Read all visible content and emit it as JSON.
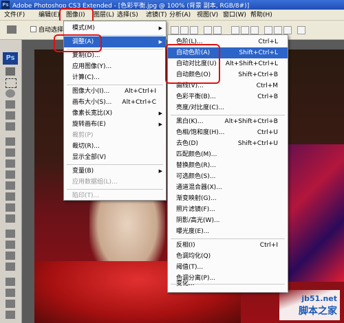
{
  "window": {
    "title": "Adobe Photoshop CS3 Extended - [色彩平衡.jpg @ 100% (背景 副本, RGB/8#)]",
    "app_badge": "Ps"
  },
  "menubar": {
    "items": [
      "文件(F)",
      "编辑(E)",
      "图像(I)",
      "图层(L)",
      "选择(S)",
      "滤镜(T)",
      "分析(A)",
      "视图(V)",
      "窗口(W)",
      "帮助(H)"
    ]
  },
  "optionsbar": {
    "auto_select_label": "自动选择"
  },
  "toolbox": {
    "badge": "Ps"
  },
  "image_menu": {
    "items": [
      {
        "label": "模式(M)",
        "shortcut": "",
        "submenu": true,
        "disabled": false
      },
      {
        "label": "调整(A)",
        "shortcut": "",
        "submenu": true,
        "disabled": false,
        "highlighted": true
      },
      {
        "label": "复制(D)...",
        "shortcut": "",
        "submenu": false,
        "disabled": false
      },
      {
        "label": "应用图像(Y)...",
        "shortcut": "",
        "submenu": false,
        "disabled": false
      },
      {
        "label": "计算(C)...",
        "shortcut": "",
        "submenu": false,
        "disabled": false
      },
      {
        "label": "图像大小(I)...",
        "shortcut": "Alt+Ctrl+I",
        "submenu": false,
        "disabled": false
      },
      {
        "label": "画布大小(S)...",
        "shortcut": "Alt+Ctrl+C",
        "submenu": false,
        "disabled": false
      },
      {
        "label": "像素长宽比(X)",
        "shortcut": "",
        "submenu": true,
        "disabled": false
      },
      {
        "label": "旋转画布(E)",
        "shortcut": "",
        "submenu": true,
        "disabled": false
      },
      {
        "label": "裁剪(P)",
        "shortcut": "",
        "submenu": false,
        "disabled": true
      },
      {
        "label": "裁切(R)...",
        "shortcut": "",
        "submenu": false,
        "disabled": false
      },
      {
        "label": "显示全部(V)",
        "shortcut": "",
        "submenu": false,
        "disabled": false
      },
      {
        "label": "变量(B)",
        "shortcut": "",
        "submenu": true,
        "disabled": false
      },
      {
        "label": "应用数据组(L)...",
        "shortcut": "",
        "submenu": false,
        "disabled": true
      },
      {
        "label": "陷印(T)...",
        "shortcut": "",
        "submenu": false,
        "disabled": true
      }
    ]
  },
  "adjust_menu": {
    "items": [
      {
        "label": "色阶(L)...",
        "shortcut": "Ctrl+L"
      },
      {
        "label": "自动色阶(A)",
        "shortcut": "Shift+Ctrl+L",
        "highlighted": true
      },
      {
        "label": "自动对比度(U)",
        "shortcut": "Alt+Shift+Ctrl+L"
      },
      {
        "label": "自动颜色(O)",
        "shortcut": "Shift+Ctrl+B"
      },
      {
        "label": "曲线(V)...",
        "shortcut": "Ctrl+M"
      },
      {
        "label": "色彩平衡(B)...",
        "shortcut": "Ctrl+B"
      },
      {
        "label": "亮度/对比度(C)...",
        "shortcut": ""
      },
      {
        "label": "黑白(K)...",
        "shortcut": "Alt+Shift+Ctrl+B"
      },
      {
        "label": "色相/饱和度(H)...",
        "shortcut": "Ctrl+U"
      },
      {
        "label": "去色(D)",
        "shortcut": "Shift+Ctrl+U"
      },
      {
        "label": "匹配颜色(M)...",
        "shortcut": ""
      },
      {
        "label": "替换颜色(R)...",
        "shortcut": ""
      },
      {
        "label": "可选颜色(S)...",
        "shortcut": ""
      },
      {
        "label": "通道混合器(X)...",
        "shortcut": ""
      },
      {
        "label": "渐变映射(G)...",
        "shortcut": ""
      },
      {
        "label": "照片滤镜(F)...",
        "shortcut": ""
      },
      {
        "label": "阴影/高光(W)...",
        "shortcut": ""
      },
      {
        "label": "曝光度(E)...",
        "shortcut": ""
      },
      {
        "label": "反相(I)",
        "shortcut": "Ctrl+I"
      },
      {
        "label": "色调均化(Q)",
        "shortcut": ""
      },
      {
        "label": "阈值(T)...",
        "shortcut": ""
      },
      {
        "label": "色调分离(P)...",
        "shortcut": ""
      },
      {
        "label": "变化...",
        "shortcut": ""
      }
    ]
  },
  "watermark": {
    "site": "jb51.net",
    "brand": "脚本之家"
  },
  "colors": {
    "highlight": "#2c64c8",
    "annotation_red": "#e01010"
  }
}
